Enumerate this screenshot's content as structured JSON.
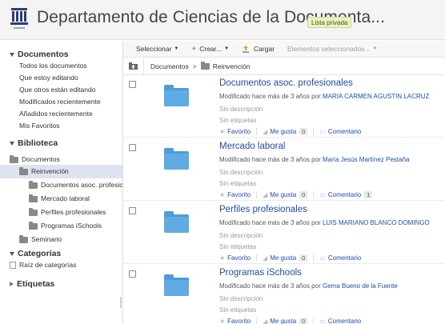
{
  "header": {
    "title": "Departamento de Ciencias de la Documenta...",
    "badge": "Lista privada"
  },
  "sidebar": {
    "documents_head": "Documentos",
    "documents_links": [
      "Todos los documentos",
      "Que estoy editando",
      "Que otros están editando",
      "Modificados recientemente",
      "Añadidos recientemente",
      "Mis Favoritos"
    ],
    "library_head": "Biblioteca",
    "tree": [
      "Documentos",
      "Reinvención",
      "Documentos asoc. profesior",
      "Mercado laboral",
      "Perfiles profesionales",
      "Programas iSchools",
      "Seminario"
    ],
    "categories_head": "Categorías",
    "categories_root": "Raíz de categorías",
    "tags_head": "Etiquetas"
  },
  "toolbar": {
    "select": "Seleccionar",
    "create": "Crear...",
    "upload": "Cargar",
    "selected_items": "Elementos seleccionados..."
  },
  "breadcrumb": {
    "root": "Documentos",
    "current": "Reinvención"
  },
  "documents": [
    {
      "title": "Documentos asoc. profesionales",
      "modified": "Modificado hace más de 3 años por",
      "author": "MARIA CARMEN AGUSTIN LACRUZ",
      "description": "Sin descripción",
      "tags": "Sin etiquetas",
      "favorite": "Favorito",
      "like": "Me gusta",
      "likes": "0",
      "comment": "Comentario",
      "comments": ""
    },
    {
      "title": "Mercado laboral",
      "modified": "Modificado hace más de 3 años por",
      "author": "María Jesús Martínez Pestaña",
      "description": "Sin descripción",
      "tags": "Sin etiquetas",
      "favorite": "Favorito",
      "like": "Me gusta",
      "likes": "0",
      "comment": "Comentario",
      "comments": "1"
    },
    {
      "title": "Perfiles profesionales",
      "modified": "Modificado hace más de 3 años por",
      "author": "LUIS MARIANO BLANCO DOMINGO",
      "description": "Sin descripción",
      "tags": "Sin etiquetas",
      "favorite": "Favorito",
      "like": "Me gusta",
      "likes": "0",
      "comment": "Comentario",
      "comments": ""
    },
    {
      "title": "Programas iSchools",
      "modified": "Modificado hace más de 3 años por",
      "author": "Gema Bueno de la Fuente",
      "description": "Sin descripción",
      "tags": "Sin etiquetas",
      "favorite": "Favorito",
      "like": "Me gusta",
      "likes": "0",
      "comment": "Comentario",
      "comments": ""
    }
  ],
  "colors": {
    "link": "#1f4ea5",
    "folder": "#5fabe3",
    "selected_row": "#dde3f0",
    "badge_bg": "#eaf2c6"
  }
}
